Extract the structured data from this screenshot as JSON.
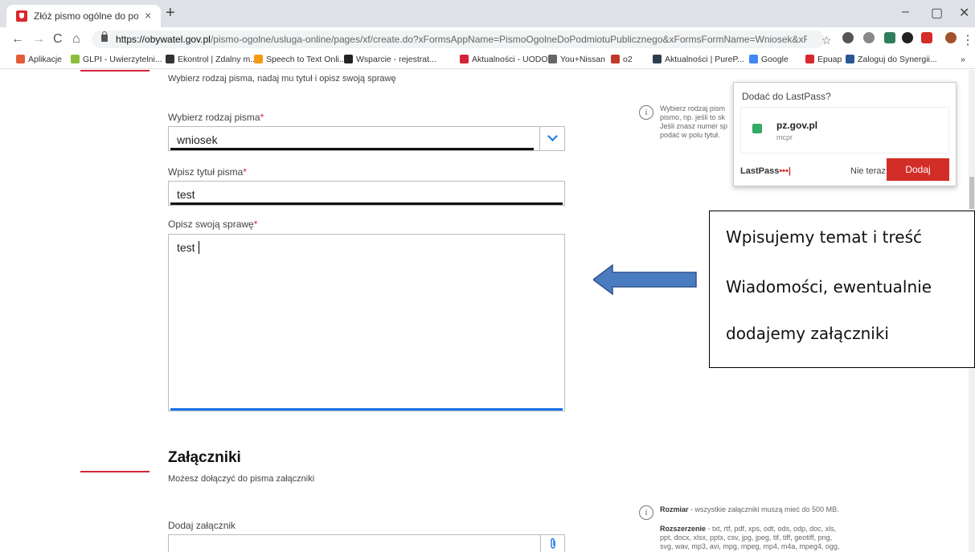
{
  "browser": {
    "tab_title": "Złóż pismo ogólne do podmiotu",
    "tab_close": "×",
    "new_tab": "+",
    "window_minimize": "–",
    "window_maximize": "▢",
    "window_close": "✕",
    "nav_back": "←",
    "nav_forward": "→",
    "nav_reload": "C",
    "nav_home": "⌂",
    "url_host": "https://obywatel.gov.pl",
    "url_path": "/pismo-ogolne/usluga-online/pages/xf/create.do?xFormsAppName=PismoOgolneDoPodmiotuPublicznego&xFormsFormName=Wniosek&xFormsO...",
    "bookmark_star": "☆",
    "menu_dots": "⋮"
  },
  "bookmarks": [
    {
      "label": "Aplikacje",
      "color": "#e25c3a"
    },
    {
      "label": "GLPI - Uwierzytelni...",
      "color": "#8bbd3c"
    },
    {
      "label": "Ekontrol | Zdalny m...",
      "color": "#333333"
    },
    {
      "label": "Speech to Text Onli...",
      "color": "#f39c12"
    },
    {
      "label": "Wsparcie - rejestrat...",
      "color": "#222222"
    },
    {
      "label": "Aktualności - UODO",
      "color": "#d5233a"
    },
    {
      "label": "You+Nissan",
      "color": "#666666"
    },
    {
      "label": "o2",
      "color": "#c0392b"
    },
    {
      "label": "Aktualności | PureP...",
      "color": "#2c3e50"
    },
    {
      "label": "Google",
      "color": "#4285f4"
    },
    {
      "label": "Epuap",
      "color": "#d9272e"
    },
    {
      "label": "Zaloguj do Synergii...",
      "color": "#2b5797"
    }
  ],
  "bookmarks_more": "»",
  "form": {
    "section_hint": "Wybierz rodzaj pisma, nadaj mu tytuł i opisz swoją sprawę",
    "type_label": "Wybierz rodzaj pisma",
    "type_value": "wniosek",
    "title_label": "Wpisz tytuł pisma",
    "title_value": "test",
    "desc_label": "Opisz swoją sprawę",
    "desc_value": "test",
    "required_mark": "*",
    "info_lines": [
      "Wybierz rodzaj pism",
      "pismo, np. jeśli to sk",
      "Jeśli znasz numer sp",
      "podać w polu tytuł."
    ]
  },
  "attachments": {
    "heading": "Załączniki",
    "subtitle": "Możesz dołączyć do pisma załączniki",
    "add_label": "Dodaj załącznik",
    "size_title": "Rozmiar",
    "size_text": " - wszystkie załączniki muszą mieć do 500 MB.",
    "ext_title": "Rozszerzenie",
    "ext_lines": [
      " - txt, rtf, pdf, xps, odt, ods, odp, doc, xls,",
      "ppt, docx, xlsx, pptx, csv, jpg, jpeg, tif, tiff, geotiff, png,",
      "svg, wav, mp3, avi, mpg, mpeg, mp4, m4a, mpeg4, ogg,"
    ]
  },
  "lastpass": {
    "header": "Dodać do LastPass?",
    "site": "pz.gov.pl",
    "user": "mcpr",
    "brand": "LastPass",
    "brand_dots": "•••|",
    "later": "Nie teraz",
    "add": "Dodaj"
  },
  "annotation": {
    "lines": [
      "Wpisujemy temat i treść",
      "Wiadomości, ewentualnie",
      "dodajemy załączniki"
    ],
    "arrow_color": "#4a7cc0"
  },
  "colors": {
    "accent_red": "#d5233a",
    "link_blue": "#1a73e8",
    "lastpass_red": "#d32d27"
  }
}
